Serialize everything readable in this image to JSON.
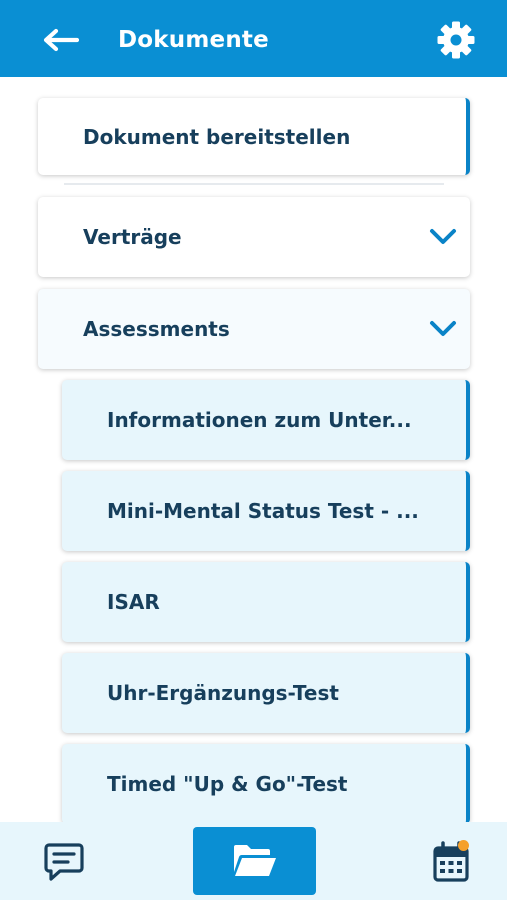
{
  "header": {
    "title": "Dokumente",
    "back_icon": "arrow-left-icon",
    "settings_icon": "gear-icon",
    "background_color": "#0a8fd3"
  },
  "sections": {
    "upload": {
      "label": "Dokument bereitstellen"
    },
    "contracts": {
      "label": "Verträge",
      "icon": "chevron-down-icon"
    },
    "assessments": {
      "label": "Assessments",
      "icon": "chevron-down-icon"
    }
  },
  "documents": [
    {
      "label": "Informationen zum Unter..."
    },
    {
      "label": "Mini-Mental Status Test - ..."
    },
    {
      "label": "ISAR"
    },
    {
      "label": "Uhr-Ergänzungs-Test"
    },
    {
      "label": "Timed \"Up & Go\"-Test"
    }
  ],
  "bottom_nav": {
    "messages_icon": "chat-icon",
    "documents_icon": "folder-open-icon",
    "calendar_icon": "calendar-icon",
    "active_color": "#0a8fd3",
    "notification_color": "#f5a02c"
  },
  "colors": {
    "accent": "#0a83c7",
    "text": "#173f5c",
    "sub_card_background": "#e7f6fc"
  }
}
